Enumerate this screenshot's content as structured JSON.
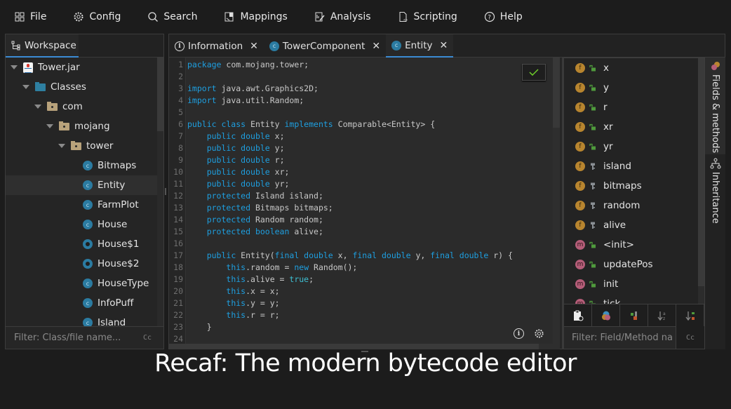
{
  "menu": [
    {
      "label": "File",
      "icon": "file-icon"
    },
    {
      "label": "Config",
      "icon": "gear-icon"
    },
    {
      "label": "Search",
      "icon": "search-icon"
    },
    {
      "label": "Mappings",
      "icon": "mappings-icon"
    },
    {
      "label": "Analysis",
      "icon": "analysis-icon"
    },
    {
      "label": "Scripting",
      "icon": "script-icon"
    },
    {
      "label": "Help",
      "icon": "help-icon"
    }
  ],
  "workspace": {
    "tab_label": "Workspace",
    "tree": [
      {
        "label": "Tower.jar",
        "type": "jar",
        "depth": 0,
        "expanded": true
      },
      {
        "label": "Classes",
        "type": "dir",
        "depth": 1,
        "expanded": true
      },
      {
        "label": "com",
        "type": "package",
        "depth": 2,
        "expanded": true
      },
      {
        "label": "mojang",
        "type": "package",
        "depth": 3,
        "expanded": true
      },
      {
        "label": "tower",
        "type": "package",
        "depth": 4,
        "expanded": true
      },
      {
        "label": "Bitmaps",
        "type": "class",
        "depth": 5
      },
      {
        "label": "Entity",
        "type": "class",
        "depth": 5,
        "selected": true
      },
      {
        "label": "FarmPlot",
        "type": "class",
        "depth": 5
      },
      {
        "label": "House",
        "type": "class",
        "depth": 5
      },
      {
        "label": "House$1",
        "type": "inner",
        "depth": 5
      },
      {
        "label": "House$2",
        "type": "inner",
        "depth": 5
      },
      {
        "label": "HouseType",
        "type": "class",
        "depth": 5
      },
      {
        "label": "InfoPuff",
        "type": "class",
        "depth": 5
      },
      {
        "label": "Island",
        "type": "class",
        "depth": 5
      }
    ],
    "filter_placeholder": "Filter: Class/file name...",
    "case_toggle": "Cc"
  },
  "editor": {
    "tabs": [
      {
        "label": "Information",
        "icon": "info-icon",
        "active": false
      },
      {
        "label": "TowerComponent",
        "icon": "class-icon",
        "active": false
      },
      {
        "label": "Entity",
        "icon": "class-icon",
        "active": true
      }
    ],
    "close_glyph": "✕",
    "code_lines": [
      [
        [
          "kw",
          "package"
        ],
        [
          "t",
          " com.mojang.tower;"
        ]
      ],
      [],
      [
        [
          "kw",
          "import"
        ],
        [
          "t",
          " java.awt.Graphics2D;"
        ]
      ],
      [
        [
          "kw",
          "import"
        ],
        [
          "t",
          " java.util.Random;"
        ]
      ],
      [],
      [
        [
          "kw",
          "public class"
        ],
        [
          "t",
          " Entity "
        ],
        [
          "kw",
          "implements"
        ],
        [
          "t",
          " Comparable<Entity> {"
        ]
      ],
      [
        [
          "t",
          "    "
        ],
        [
          "kw",
          "public double"
        ],
        [
          "t",
          " x;"
        ]
      ],
      [
        [
          "t",
          "    "
        ],
        [
          "kw",
          "public double"
        ],
        [
          "t",
          " y;"
        ]
      ],
      [
        [
          "t",
          "    "
        ],
        [
          "kw",
          "public double"
        ],
        [
          "t",
          " r;"
        ]
      ],
      [
        [
          "t",
          "    "
        ],
        [
          "kw",
          "public double"
        ],
        [
          "t",
          " xr;"
        ]
      ],
      [
        [
          "t",
          "    "
        ],
        [
          "kw",
          "public double"
        ],
        [
          "t",
          " yr;"
        ]
      ],
      [
        [
          "t",
          "    "
        ],
        [
          "kw",
          "protected"
        ],
        [
          "t",
          " Island island;"
        ]
      ],
      [
        [
          "t",
          "    "
        ],
        [
          "kw",
          "protected"
        ],
        [
          "t",
          " Bitmaps bitmaps;"
        ]
      ],
      [
        [
          "t",
          "    "
        ],
        [
          "kw",
          "protected"
        ],
        [
          "t",
          " Random random;"
        ]
      ],
      [
        [
          "t",
          "    "
        ],
        [
          "kw",
          "protected boolean"
        ],
        [
          "t",
          " alive;"
        ]
      ],
      [],
      [
        [
          "t",
          "    "
        ],
        [
          "kw",
          "public"
        ],
        [
          "t",
          " Entity("
        ],
        [
          "kw",
          "final double"
        ],
        [
          "t",
          " x, "
        ],
        [
          "kw",
          "final double"
        ],
        [
          "t",
          " y, "
        ],
        [
          "kw",
          "final double"
        ],
        [
          "t",
          " r) {"
        ]
      ],
      [
        [
          "t",
          "        "
        ],
        [
          "kw",
          "this"
        ],
        [
          "t",
          ".random = "
        ],
        [
          "kw",
          "new"
        ],
        [
          "t",
          " Random();"
        ]
      ],
      [
        [
          "t",
          "        "
        ],
        [
          "kw",
          "this"
        ],
        [
          "t",
          ".alive = "
        ],
        [
          "lit",
          "true"
        ],
        [
          "t",
          ";"
        ]
      ],
      [
        [
          "t",
          "        "
        ],
        [
          "kw",
          "this"
        ],
        [
          "t",
          ".x = x;"
        ]
      ],
      [
        [
          "t",
          "        "
        ],
        [
          "kw",
          "this"
        ],
        [
          "t",
          ".y = y;"
        ]
      ],
      [
        [
          "t",
          "        "
        ],
        [
          "kw",
          "this"
        ],
        [
          "t",
          ".r = r;"
        ]
      ],
      [
        [
          "t",
          "    }"
        ]
      ],
      []
    ]
  },
  "members": {
    "items": [
      {
        "kind": "f",
        "access": "public",
        "name": "x"
      },
      {
        "kind": "f",
        "access": "public",
        "name": "y"
      },
      {
        "kind": "f",
        "access": "public",
        "name": "r"
      },
      {
        "kind": "f",
        "access": "public",
        "name": "xr"
      },
      {
        "kind": "f",
        "access": "public",
        "name": "yr"
      },
      {
        "kind": "f",
        "access": "protected",
        "name": "island"
      },
      {
        "kind": "f",
        "access": "protected",
        "name": "bitmaps"
      },
      {
        "kind": "f",
        "access": "protected",
        "name": "random"
      },
      {
        "kind": "f",
        "access": "protected",
        "name": "alive"
      },
      {
        "kind": "m",
        "access": "public",
        "name": "<init>"
      },
      {
        "kind": "m",
        "access": "public",
        "name": "updatePos"
      },
      {
        "kind": "m",
        "access": "public",
        "name": "init"
      },
      {
        "kind": "m",
        "access": "public",
        "name": "tick"
      }
    ],
    "toolbar": [
      "show-synthetics-toggle",
      "show-types-toggle",
      "show-access-toggle",
      "sort-alpha-toggle",
      "sort-visibility-toggle"
    ],
    "filter_placeholder": "Filter: Field/Method name...",
    "case_toggle": "Cc"
  },
  "side_tabs": {
    "fields_methods": "Fields & methods",
    "inheritance": "Inheritance"
  },
  "caption": "Recaf: The modern bytecode editor",
  "colors": {
    "accent": "#3b8bd4",
    "keyword": "#1e9fe0",
    "field_badge": "#b8852f",
    "method_badge": "#b45d78",
    "class_icon": "#2b7ba1",
    "public_access": "#4f9a3c",
    "check": "#6fcf2a"
  }
}
